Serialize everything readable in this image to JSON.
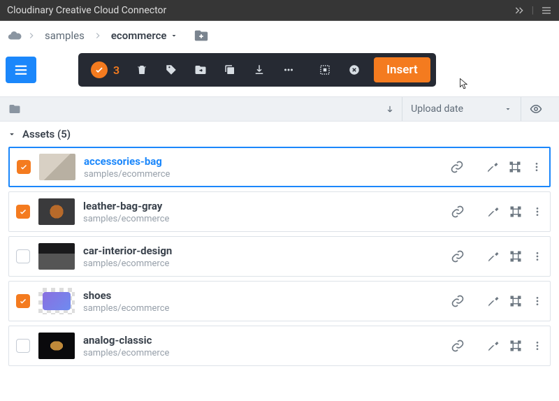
{
  "window": {
    "title": "Cloudinary Creative Cloud Connector"
  },
  "breadcrumb": {
    "items": [
      "samples",
      "ecommerce"
    ]
  },
  "toolbar": {
    "selected_count": "3",
    "insert_label": "Insert"
  },
  "sort": {
    "field": "Upload date"
  },
  "assets_header": {
    "label": "Assets (5)"
  },
  "rows": [
    {
      "name": "accessories-bag",
      "path": "samples/ecommerce",
      "checked": true,
      "highlight": true
    },
    {
      "name": "leather-bag-gray",
      "path": "samples/ecommerce",
      "checked": true,
      "highlight": false
    },
    {
      "name": "car-interior-design",
      "path": "samples/ecommerce",
      "checked": false,
      "highlight": false
    },
    {
      "name": "shoes",
      "path": "samples/ecommerce",
      "checked": true,
      "highlight": false
    },
    {
      "name": "analog-classic",
      "path": "samples/ecommerce",
      "checked": false,
      "highlight": false
    }
  ]
}
